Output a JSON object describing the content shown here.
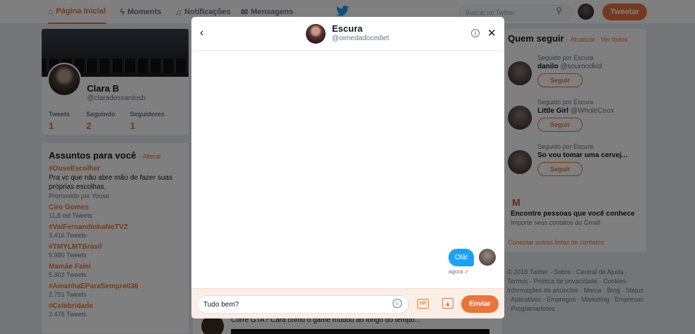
{
  "nav": {
    "home": "Página Inicial",
    "moments": "Moments",
    "notifications": "Notificações",
    "messages": "Mensagens",
    "search_placeholder": "Buscar no Twitter",
    "tweet_button": "Tweetar"
  },
  "profile": {
    "name": "Clara B",
    "handle": "@claradossantosb",
    "stats": [
      {
        "label": "Tweets",
        "value": "1"
      },
      {
        "label": "Seguindo",
        "value": "2"
      },
      {
        "label": "Seguidores",
        "value": "1"
      }
    ]
  },
  "trends": {
    "title": "Assuntos para você",
    "change": "· Alterar",
    "items": [
      {
        "name": "#OuseEscolher",
        "desc": "Pra vc que não abre mão de fazer suas próprias escolhas.",
        "sub": "Promovido por Youse"
      },
      {
        "name": "Ciro Gomes",
        "sub": "11,8 mil Tweets"
      },
      {
        "name": "#VaiFernandinhaNoTVZ",
        "sub": "3.416 Tweets"
      },
      {
        "name": "#TMYLMTBrasil",
        "sub": "9.980 Tweets"
      },
      {
        "name": "Mamãe Falei",
        "sub": "5.903 Tweets"
      },
      {
        "name": "#AmanhaEParaSempre036",
        "sub": "2.751 Tweets"
      },
      {
        "name": "#Celebridade",
        "sub": "2.475 Tweets"
      }
    ]
  },
  "feed": {
    "snippet": "Corre GTA? Cara como o game mudou ao longo do tempo..."
  },
  "who_to_follow": {
    "title": "Quem seguir",
    "links": "· Atualizar · Ver todos",
    "items": [
      {
        "context": "Seguido por Escura",
        "name": "danilo",
        "handle": "@souroodkid",
        "button": "Seguir"
      },
      {
        "context": "Seguido por Escura",
        "name": "Little Girl",
        "handle": "@WholeCeox",
        "button": "Seguir"
      },
      {
        "context": "Seguido por Escura",
        "name": "So vou tomar uma cervej...",
        "handle": "",
        "button": "Seguir"
      }
    ],
    "find_title": "Encontre pessoas que você conhece",
    "find_sub": "Importe seus contatos do Gmail",
    "connect": "Conectar outras listas de contatos"
  },
  "footer": {
    "links": "© 2018 Twitter · Sobre · Central de Ajuda · Termos · Política de privacidade · Cookies · Informações de anúncios · Marca · Blog · Status · Aplicativos · Empregos · Marketing · Empresas · Programadores"
  },
  "dm": {
    "name": "Escura",
    "handle": "@oimedadocediet",
    "message": "Olá!",
    "time": "agora ✓",
    "input_value": "Tudo bem?",
    "send_label": "Enviar",
    "gif_label": "GIF"
  },
  "colors": {
    "accent": "#e8753a",
    "bubble": "#1da1f2"
  }
}
